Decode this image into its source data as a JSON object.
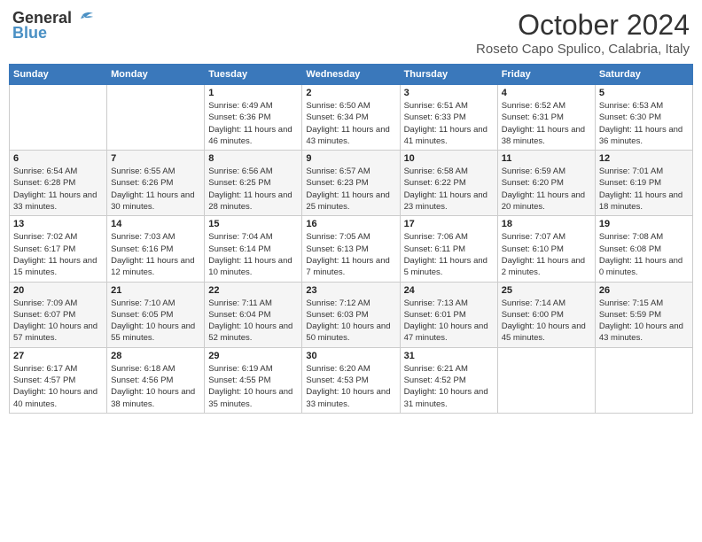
{
  "header": {
    "logo_line1": "General",
    "logo_line2": "Blue",
    "month": "October 2024",
    "location": "Roseto Capo Spulico, Calabria, Italy"
  },
  "weekdays": [
    "Sunday",
    "Monday",
    "Tuesday",
    "Wednesday",
    "Thursday",
    "Friday",
    "Saturday"
  ],
  "weeks": [
    [
      {
        "day": "",
        "info": ""
      },
      {
        "day": "",
        "info": ""
      },
      {
        "day": "1",
        "info": "Sunrise: 6:49 AM\nSunset: 6:36 PM\nDaylight: 11 hours and 46 minutes."
      },
      {
        "day": "2",
        "info": "Sunrise: 6:50 AM\nSunset: 6:34 PM\nDaylight: 11 hours and 43 minutes."
      },
      {
        "day": "3",
        "info": "Sunrise: 6:51 AM\nSunset: 6:33 PM\nDaylight: 11 hours and 41 minutes."
      },
      {
        "day": "4",
        "info": "Sunrise: 6:52 AM\nSunset: 6:31 PM\nDaylight: 11 hours and 38 minutes."
      },
      {
        "day": "5",
        "info": "Sunrise: 6:53 AM\nSunset: 6:30 PM\nDaylight: 11 hours and 36 minutes."
      }
    ],
    [
      {
        "day": "6",
        "info": "Sunrise: 6:54 AM\nSunset: 6:28 PM\nDaylight: 11 hours and 33 minutes."
      },
      {
        "day": "7",
        "info": "Sunrise: 6:55 AM\nSunset: 6:26 PM\nDaylight: 11 hours and 30 minutes."
      },
      {
        "day": "8",
        "info": "Sunrise: 6:56 AM\nSunset: 6:25 PM\nDaylight: 11 hours and 28 minutes."
      },
      {
        "day": "9",
        "info": "Sunrise: 6:57 AM\nSunset: 6:23 PM\nDaylight: 11 hours and 25 minutes."
      },
      {
        "day": "10",
        "info": "Sunrise: 6:58 AM\nSunset: 6:22 PM\nDaylight: 11 hours and 23 minutes."
      },
      {
        "day": "11",
        "info": "Sunrise: 6:59 AM\nSunset: 6:20 PM\nDaylight: 11 hours and 20 minutes."
      },
      {
        "day": "12",
        "info": "Sunrise: 7:01 AM\nSunset: 6:19 PM\nDaylight: 11 hours and 18 minutes."
      }
    ],
    [
      {
        "day": "13",
        "info": "Sunrise: 7:02 AM\nSunset: 6:17 PM\nDaylight: 11 hours and 15 minutes."
      },
      {
        "day": "14",
        "info": "Sunrise: 7:03 AM\nSunset: 6:16 PM\nDaylight: 11 hours and 12 minutes."
      },
      {
        "day": "15",
        "info": "Sunrise: 7:04 AM\nSunset: 6:14 PM\nDaylight: 11 hours and 10 minutes."
      },
      {
        "day": "16",
        "info": "Sunrise: 7:05 AM\nSunset: 6:13 PM\nDaylight: 11 hours and 7 minutes."
      },
      {
        "day": "17",
        "info": "Sunrise: 7:06 AM\nSunset: 6:11 PM\nDaylight: 11 hours and 5 minutes."
      },
      {
        "day": "18",
        "info": "Sunrise: 7:07 AM\nSunset: 6:10 PM\nDaylight: 11 hours and 2 minutes."
      },
      {
        "day": "19",
        "info": "Sunrise: 7:08 AM\nSunset: 6:08 PM\nDaylight: 11 hours and 0 minutes."
      }
    ],
    [
      {
        "day": "20",
        "info": "Sunrise: 7:09 AM\nSunset: 6:07 PM\nDaylight: 10 hours and 57 minutes."
      },
      {
        "day": "21",
        "info": "Sunrise: 7:10 AM\nSunset: 6:05 PM\nDaylight: 10 hours and 55 minutes."
      },
      {
        "day": "22",
        "info": "Sunrise: 7:11 AM\nSunset: 6:04 PM\nDaylight: 10 hours and 52 minutes."
      },
      {
        "day": "23",
        "info": "Sunrise: 7:12 AM\nSunset: 6:03 PM\nDaylight: 10 hours and 50 minutes."
      },
      {
        "day": "24",
        "info": "Sunrise: 7:13 AM\nSunset: 6:01 PM\nDaylight: 10 hours and 47 minutes."
      },
      {
        "day": "25",
        "info": "Sunrise: 7:14 AM\nSunset: 6:00 PM\nDaylight: 10 hours and 45 minutes."
      },
      {
        "day": "26",
        "info": "Sunrise: 7:15 AM\nSunset: 5:59 PM\nDaylight: 10 hours and 43 minutes."
      }
    ],
    [
      {
        "day": "27",
        "info": "Sunrise: 6:17 AM\nSunset: 4:57 PM\nDaylight: 10 hours and 40 minutes."
      },
      {
        "day": "28",
        "info": "Sunrise: 6:18 AM\nSunset: 4:56 PM\nDaylight: 10 hours and 38 minutes."
      },
      {
        "day": "29",
        "info": "Sunrise: 6:19 AM\nSunset: 4:55 PM\nDaylight: 10 hours and 35 minutes."
      },
      {
        "day": "30",
        "info": "Sunrise: 6:20 AM\nSunset: 4:53 PM\nDaylight: 10 hours and 33 minutes."
      },
      {
        "day": "31",
        "info": "Sunrise: 6:21 AM\nSunset: 4:52 PM\nDaylight: 10 hours and 31 minutes."
      },
      {
        "day": "",
        "info": ""
      },
      {
        "day": "",
        "info": ""
      }
    ]
  ]
}
